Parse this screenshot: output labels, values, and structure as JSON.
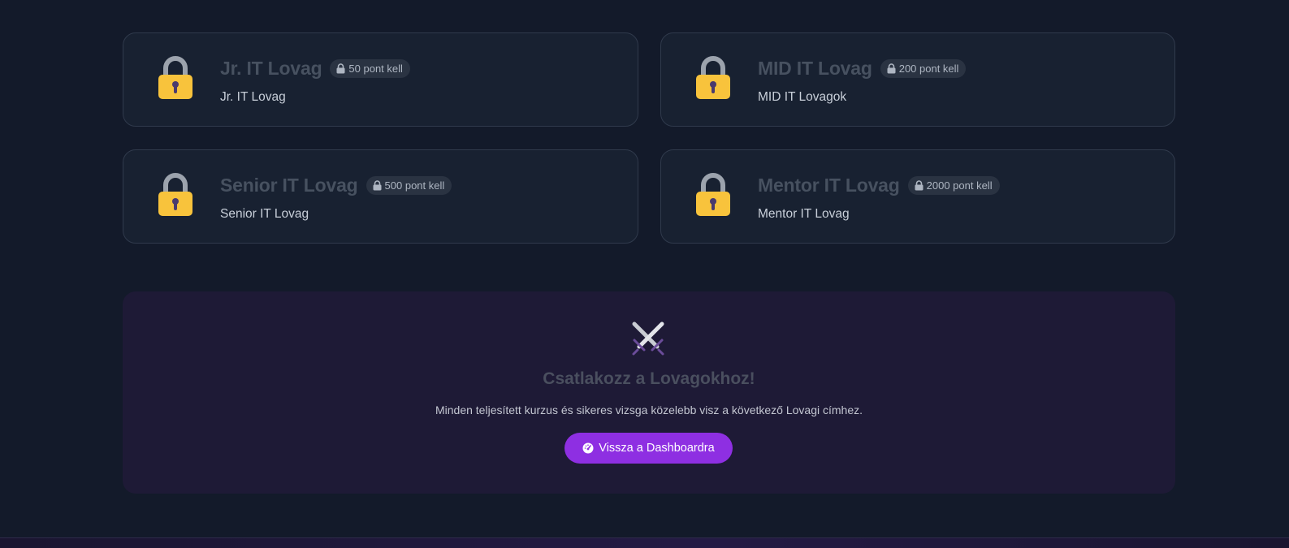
{
  "ranks": [
    {
      "title": "Jr. IT Lovag",
      "badge": "50 pont kell",
      "description": "Jr. IT Lovag"
    },
    {
      "title": "MID IT Lovag",
      "badge": "200 pont kell",
      "description": "MID IT Lovagok"
    },
    {
      "title": "Senior IT Lovag",
      "badge": "500 pont kell",
      "description": "Senior IT Lovag"
    },
    {
      "title": "Mentor IT Lovag",
      "badge": "2000 pont kell",
      "description": "Mentor IT Lovag"
    }
  ],
  "cta": {
    "icon": "crossed-swords-icon",
    "headline": "Csatlakozz a Lovagokhoz!",
    "subtext": "Minden teljesített kurzus és sikeres vizsga közelebb visz a következő Lovagi címhez.",
    "button_label": "Vissza a Dashboardra",
    "button_icon": "dashboard-gauge-icon"
  },
  "colors": {
    "background": "#131a2a",
    "card": "#182131",
    "lock": "#f8c33c",
    "accent": "#8e2fe2"
  }
}
